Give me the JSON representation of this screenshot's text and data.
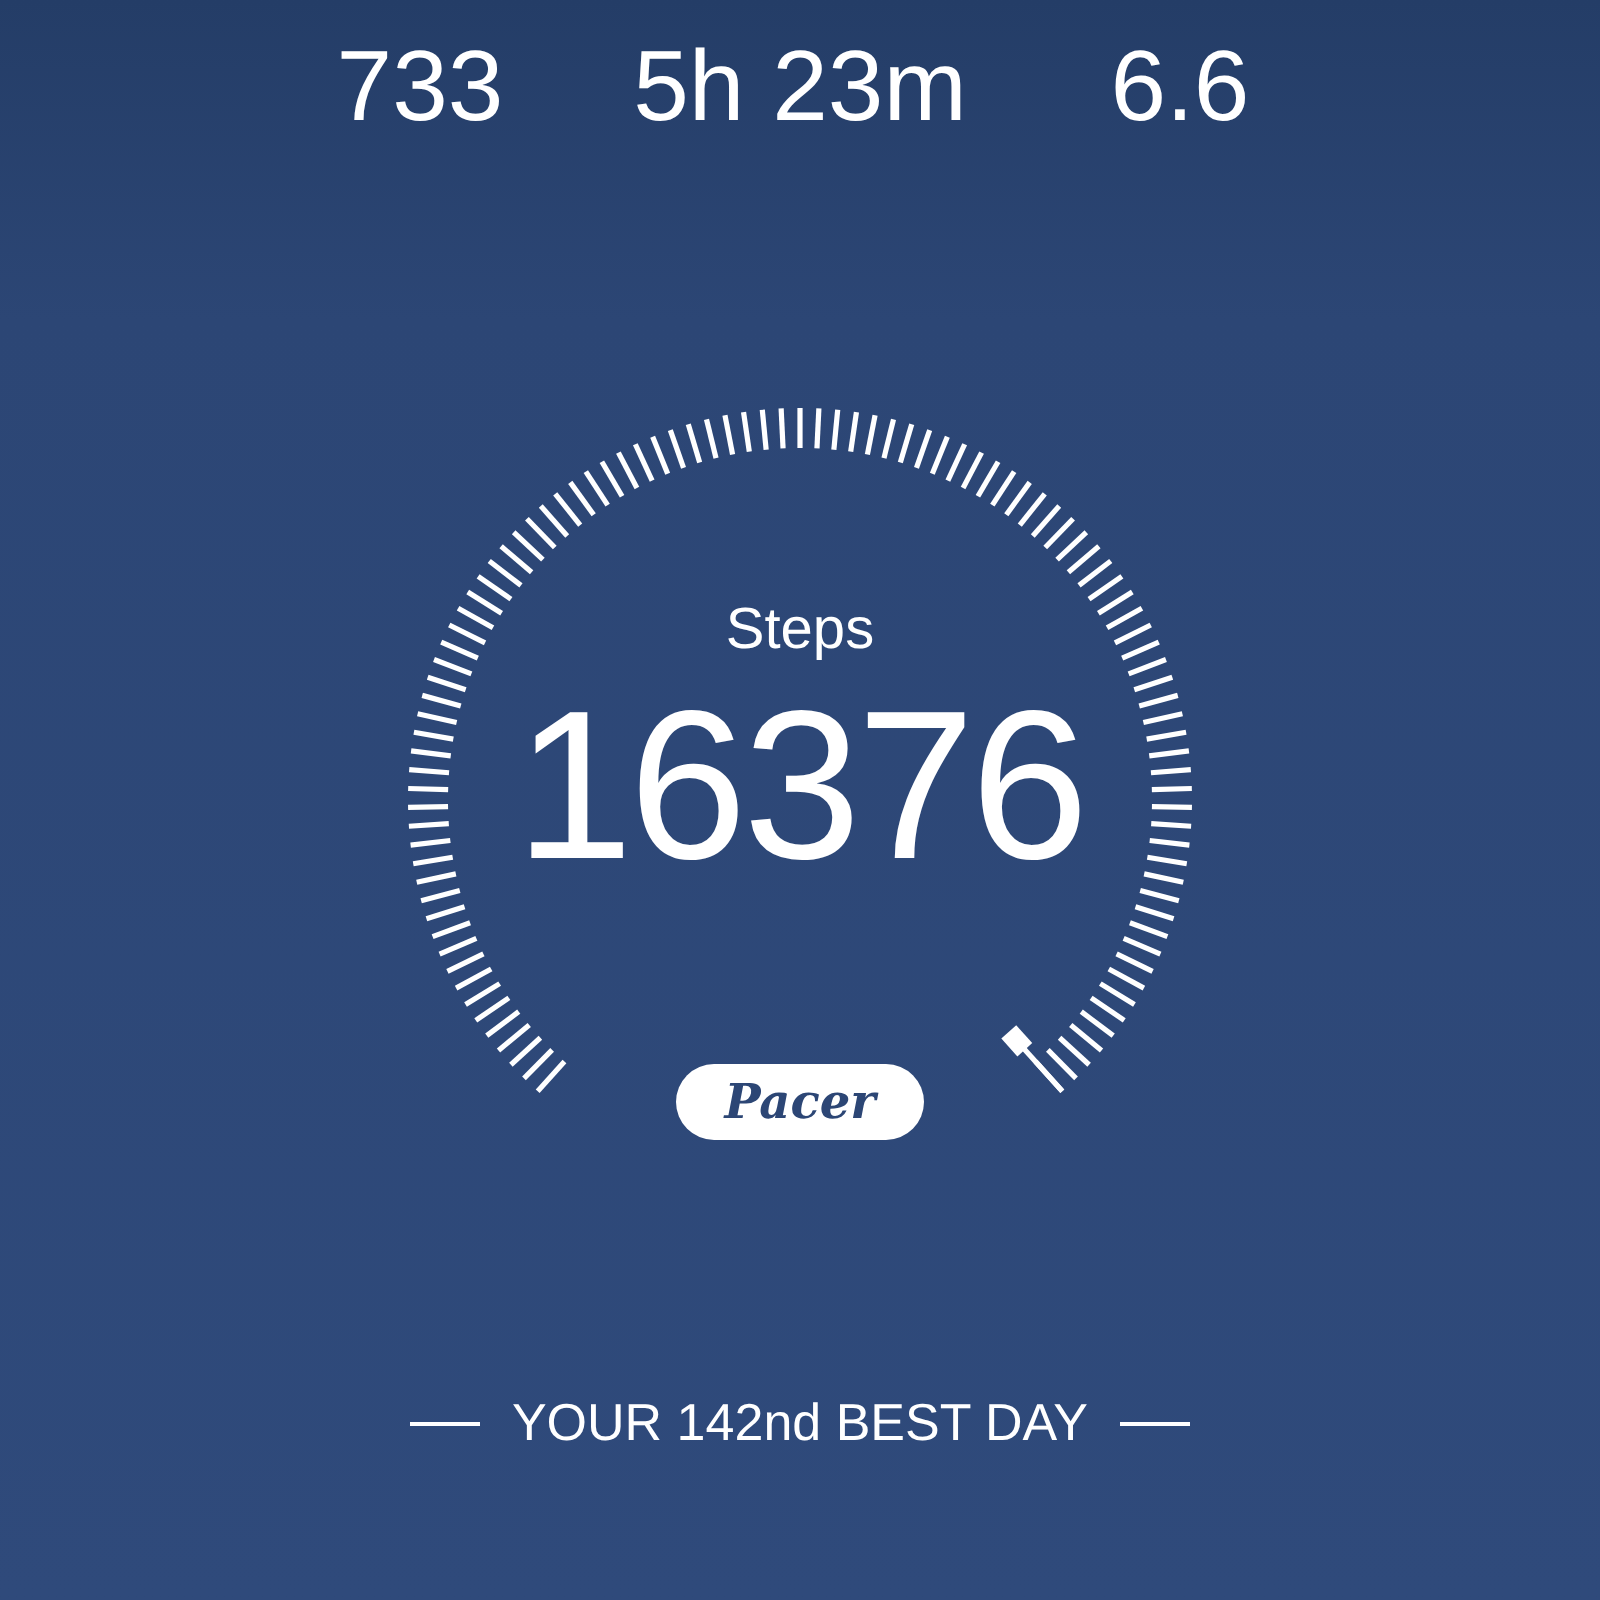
{
  "stats": [
    {
      "value": "733"
    },
    {
      "value": "5h 23m"
    },
    {
      "value": "6.6"
    }
  ],
  "gauge": {
    "label": "Steps",
    "value": "16376"
  },
  "logo": {
    "text": "Pacer"
  },
  "footer": {
    "text": "YOUR 142nd BEST DAY"
  }
}
